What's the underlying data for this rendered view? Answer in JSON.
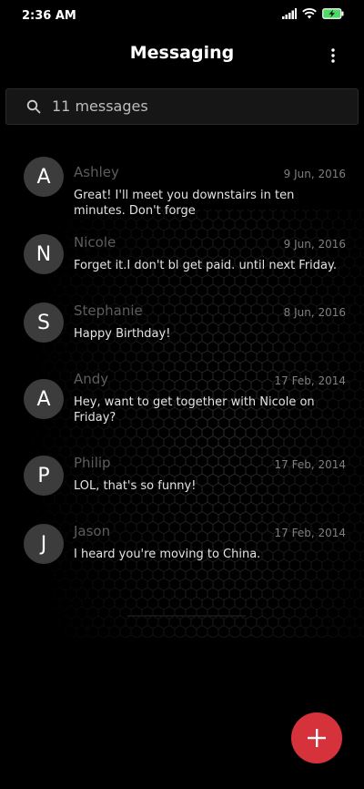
{
  "status_bar": {
    "time": "2:36 AM",
    "icons": [
      "signal-icon",
      "wifi-icon",
      "battery-charging-icon"
    ]
  },
  "app_bar": {
    "title": "Messaging",
    "menu_icon": "more-vertical-icon"
  },
  "search": {
    "icon": "search-icon",
    "text": "11 messages"
  },
  "messages": [
    {
      "initial": "A",
      "sender": "Ashley",
      "date": "9 Jun, 2016",
      "preview": "Great! I'll meet you downstairs in ten minutes. Don't forge"
    },
    {
      "initial": "N",
      "sender": "Nicole",
      "date": "9 Jun, 2016",
      "preview": "Forget it.I don't bl get paid. until next Friday."
    },
    {
      "initial": "S",
      "sender": "Stephanie",
      "date": "8 Jun, 2016",
      "preview": "Happy Birthday!"
    },
    {
      "initial": "A",
      "sender": "Andy",
      "date": "17 Feb, 2014",
      "preview": "Hey, want to get together with Nicole on Friday?"
    },
    {
      "initial": "P",
      "sender": "Philip",
      "date": "17 Feb, 2014",
      "preview": "LOL, that's so funny!"
    },
    {
      "initial": "J",
      "sender": "Jason",
      "date": "17 Feb, 2014",
      "preview": "I heard you're moving to China."
    }
  ],
  "fab": {
    "icon": "plus-icon"
  },
  "colors": {
    "background": "#000000",
    "accent": "#d6323c",
    "avatar": "#3c3c3c"
  }
}
